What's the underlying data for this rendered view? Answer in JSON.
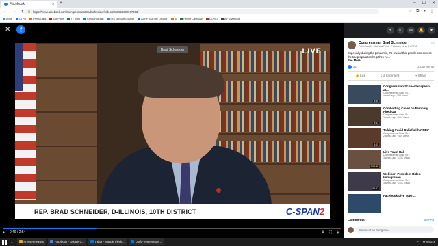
{
  "browser": {
    "tab_title": "Facebook",
    "url": "https://www.facebook.com/CongressmanBradSchneider/videos/868568082677263/",
    "bookmarks": [
      "Apps",
      "OTPR",
      "Press Clips",
      "Tax Page",
      "TY Tyes",
      "Creator Studio",
      "IRS Tax Site Locator",
      "AARP Tax Site Locator",
      "ID",
      "Phone Calendar",
      "COVID",
      "AP Stylebook"
    ]
  },
  "video": {
    "name_tag": "Brad Schneider",
    "live_label": "LIVE",
    "lower_third": "REP. BRAD SCHNEIDER, D-ILLINOIS, 10TH DISTRICT",
    "network": "C-SPAN",
    "network_num": "2",
    "time": "0:49 / 2:54",
    "progress": 0.28
  },
  "post": {
    "author": "Congressman Brad Schneider",
    "meta": "Published by Matthew Fried · February 18 at 5:47 PM",
    "text": "Especially during the pandemic, it's crucial that people can access the tax preparation help they ne...",
    "see_more": "See More",
    "likes": "22",
    "comments_count": "2 Comments",
    "actions": [
      "Like",
      "Comment",
      "Share"
    ]
  },
  "related": [
    {
      "title": "Congressman Schneider speaks at...",
      "author": "Congressman Brad Sc...",
      "meta": "a week ago · 959 Views",
      "duration": "3:34"
    },
    {
      "title": "Combatting Covid on Flannery Fired Up",
      "author": "Congressman Brad Sc...",
      "meta": "2 weeks ago · 624 Views",
      "duration": "9:37"
    },
    {
      "title": "Talking Covid Relief with CNBC",
      "author": "Congressman Brad Sc...",
      "meta": "2 weeks ago · 444 Views",
      "duration": "4:01"
    },
    {
      "title": "Live Town Hall",
      "author": "Congressman Brad Sc...",
      "meta": "3 weeks ago · 1.3K Views",
      "duration": "1:08:39"
    },
    {
      "title": "Webinar: President Biden Immigration...",
      "author": "Congressman Brad Sc...",
      "meta": "3 weeks ago · 1.4K Views",
      "duration": "58:57"
    },
    {
      "title": "Facebook Live Town...",
      "author": "",
      "meta": "",
      "duration": ""
    }
  ],
  "comments": {
    "header": "Comments",
    "see_all": "See All",
    "placeholder": "Comment as Congress..."
  },
  "taskbar": {
    "apps": [
      "Press Releases",
      "Facebook - Google C...",
      "Inbox - Maggie Flenk...",
      "Draft - eNewsletter ..."
    ],
    "time": "11:53 AM"
  }
}
